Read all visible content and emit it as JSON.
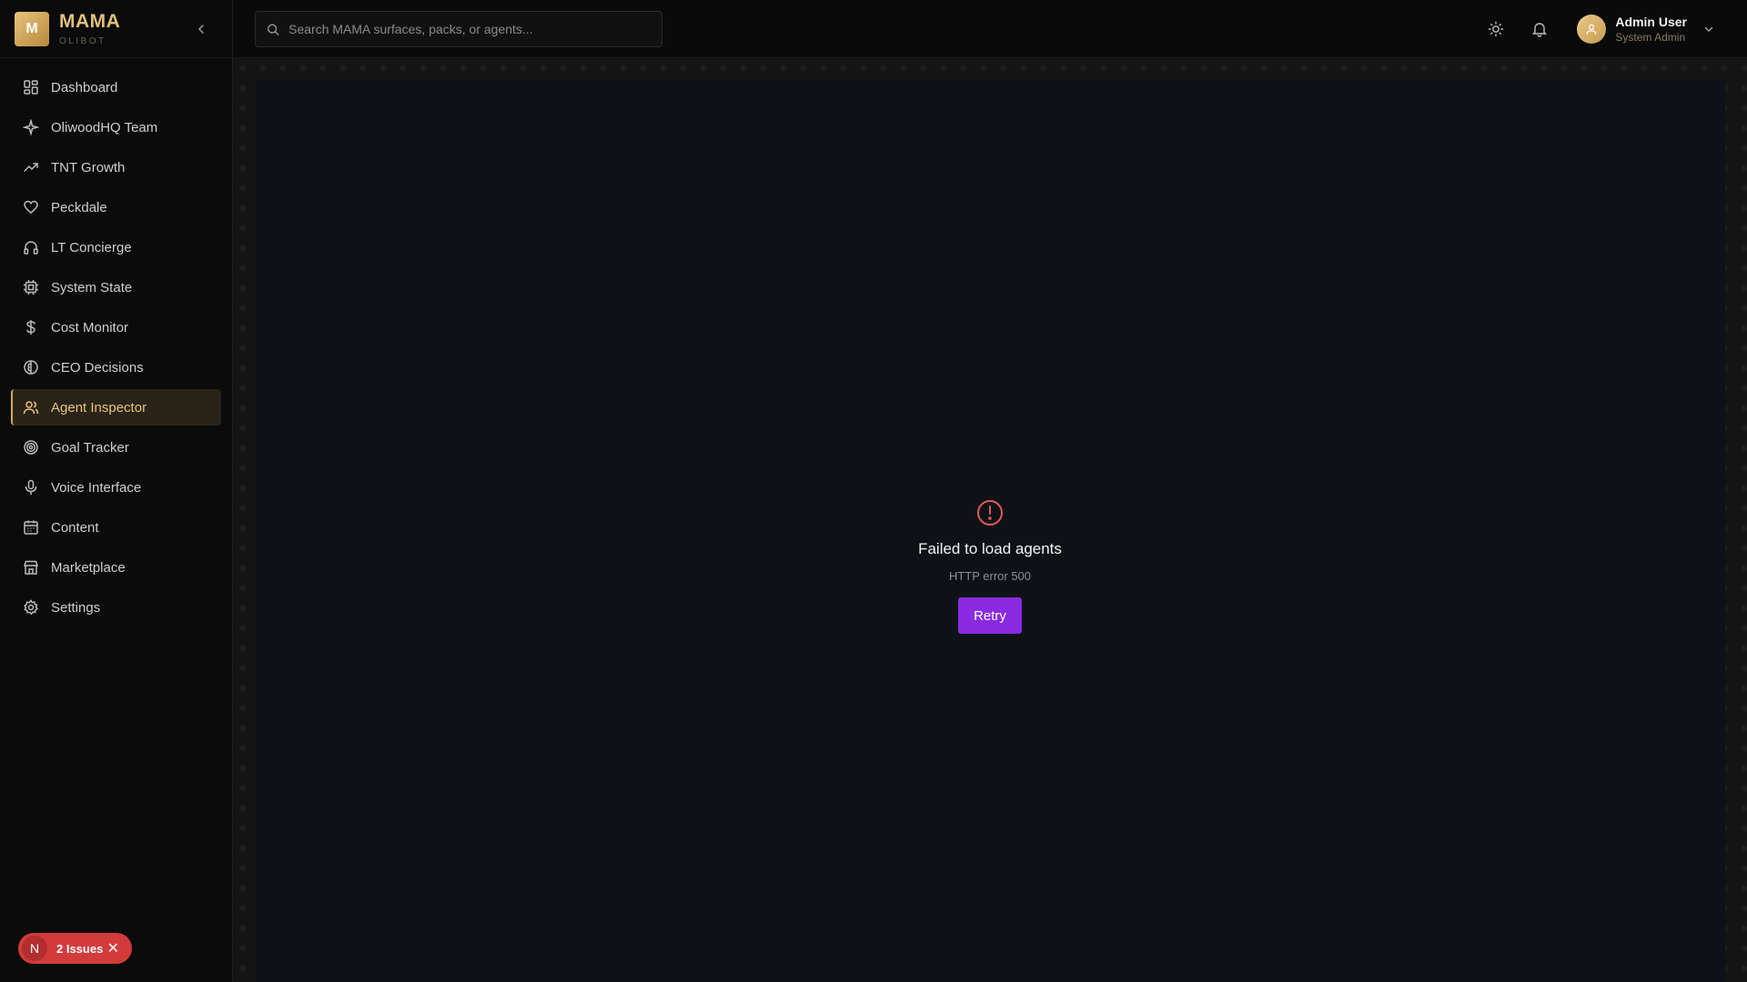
{
  "brand": {
    "logo_letter": "M",
    "name": "MAMA",
    "subtitle": "OLIBOT"
  },
  "sidebar": {
    "items": [
      {
        "label": "Dashboard",
        "icon": "dashboard-icon"
      },
      {
        "label": "OliwoodHQ Team",
        "icon": "sparkles-icon"
      },
      {
        "label": "TNT Growth",
        "icon": "trending-up-icon"
      },
      {
        "label": "Peckdale",
        "icon": "heart-icon"
      },
      {
        "label": "LT Concierge",
        "icon": "headphones-icon"
      },
      {
        "label": "System State",
        "icon": "cpu-icon"
      },
      {
        "label": "Cost Monitor",
        "icon": "dollar-icon"
      },
      {
        "label": "CEO Decisions",
        "icon": "brain-icon"
      },
      {
        "label": "Agent Inspector",
        "icon": "users-icon",
        "active": true
      },
      {
        "label": "Goal Tracker",
        "icon": "target-icon"
      },
      {
        "label": "Voice Interface",
        "icon": "microphone-icon"
      },
      {
        "label": "Content",
        "icon": "calendar-icon"
      },
      {
        "label": "Marketplace",
        "icon": "store-icon"
      },
      {
        "label": "Settings",
        "icon": "gear-icon"
      }
    ]
  },
  "header": {
    "search_placeholder": "Search MAMA surfaces, packs, or agents...",
    "user": {
      "name": "Admin User",
      "role": "System Admin"
    }
  },
  "error": {
    "title": "Failed to load agents",
    "detail": "HTTP error 500",
    "retry_label": "Retry"
  },
  "issues": {
    "letter": "N",
    "label": "2 Issues"
  },
  "colors": {
    "accent": "#e3c07a",
    "retry": "#8a2be2",
    "error": "#e05a5a",
    "issues": "#d33b3b"
  }
}
